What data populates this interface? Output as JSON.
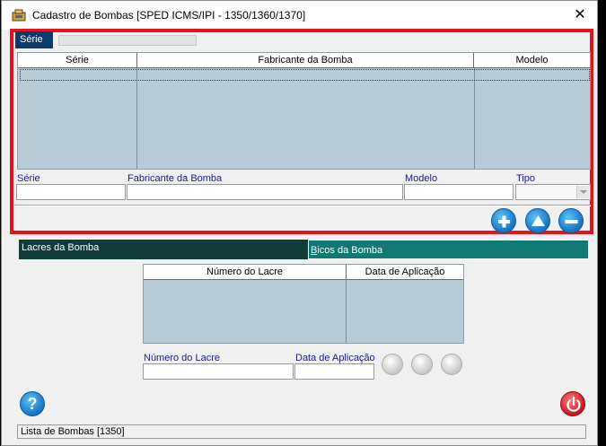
{
  "window": {
    "title": "Cadastro de Bombas  [SPED ICMS/IPI - 1350/1360/1370]",
    "close_glyph": "✕"
  },
  "bombas": {
    "filter_tab": "Série",
    "grid_headers": [
      "Série",
      "Fabricante da Bomba",
      "Modelo"
    ],
    "fields": {
      "serie_label": "Série",
      "fabricante_label": "Fabricante da Bomba",
      "modelo_label": "Modelo",
      "tipo_label": "Tipo"
    },
    "buttons": [
      "add-icon",
      "move-up-icon",
      "remove-icon"
    ]
  },
  "tabs": {
    "lacres": "Lacres da Bomba",
    "bicos_first": "B",
    "bicos_rest": "icos da Bomba"
  },
  "lacres": {
    "grid_headers": [
      "Número do Lacre",
      "Data de Aplicação"
    ],
    "fields": {
      "numero_label": "Número do Lacre",
      "data_label": "Data de Aplicação"
    }
  },
  "footer": {
    "help_glyph": "?",
    "status": "Lista de Bombas [1350]"
  },
  "colors": {
    "accent_frame": "#e3141e",
    "grid_bg": "#b8ccd6",
    "tab_active": "#0f3d3a",
    "tab_inactive": "#0f7a73"
  }
}
